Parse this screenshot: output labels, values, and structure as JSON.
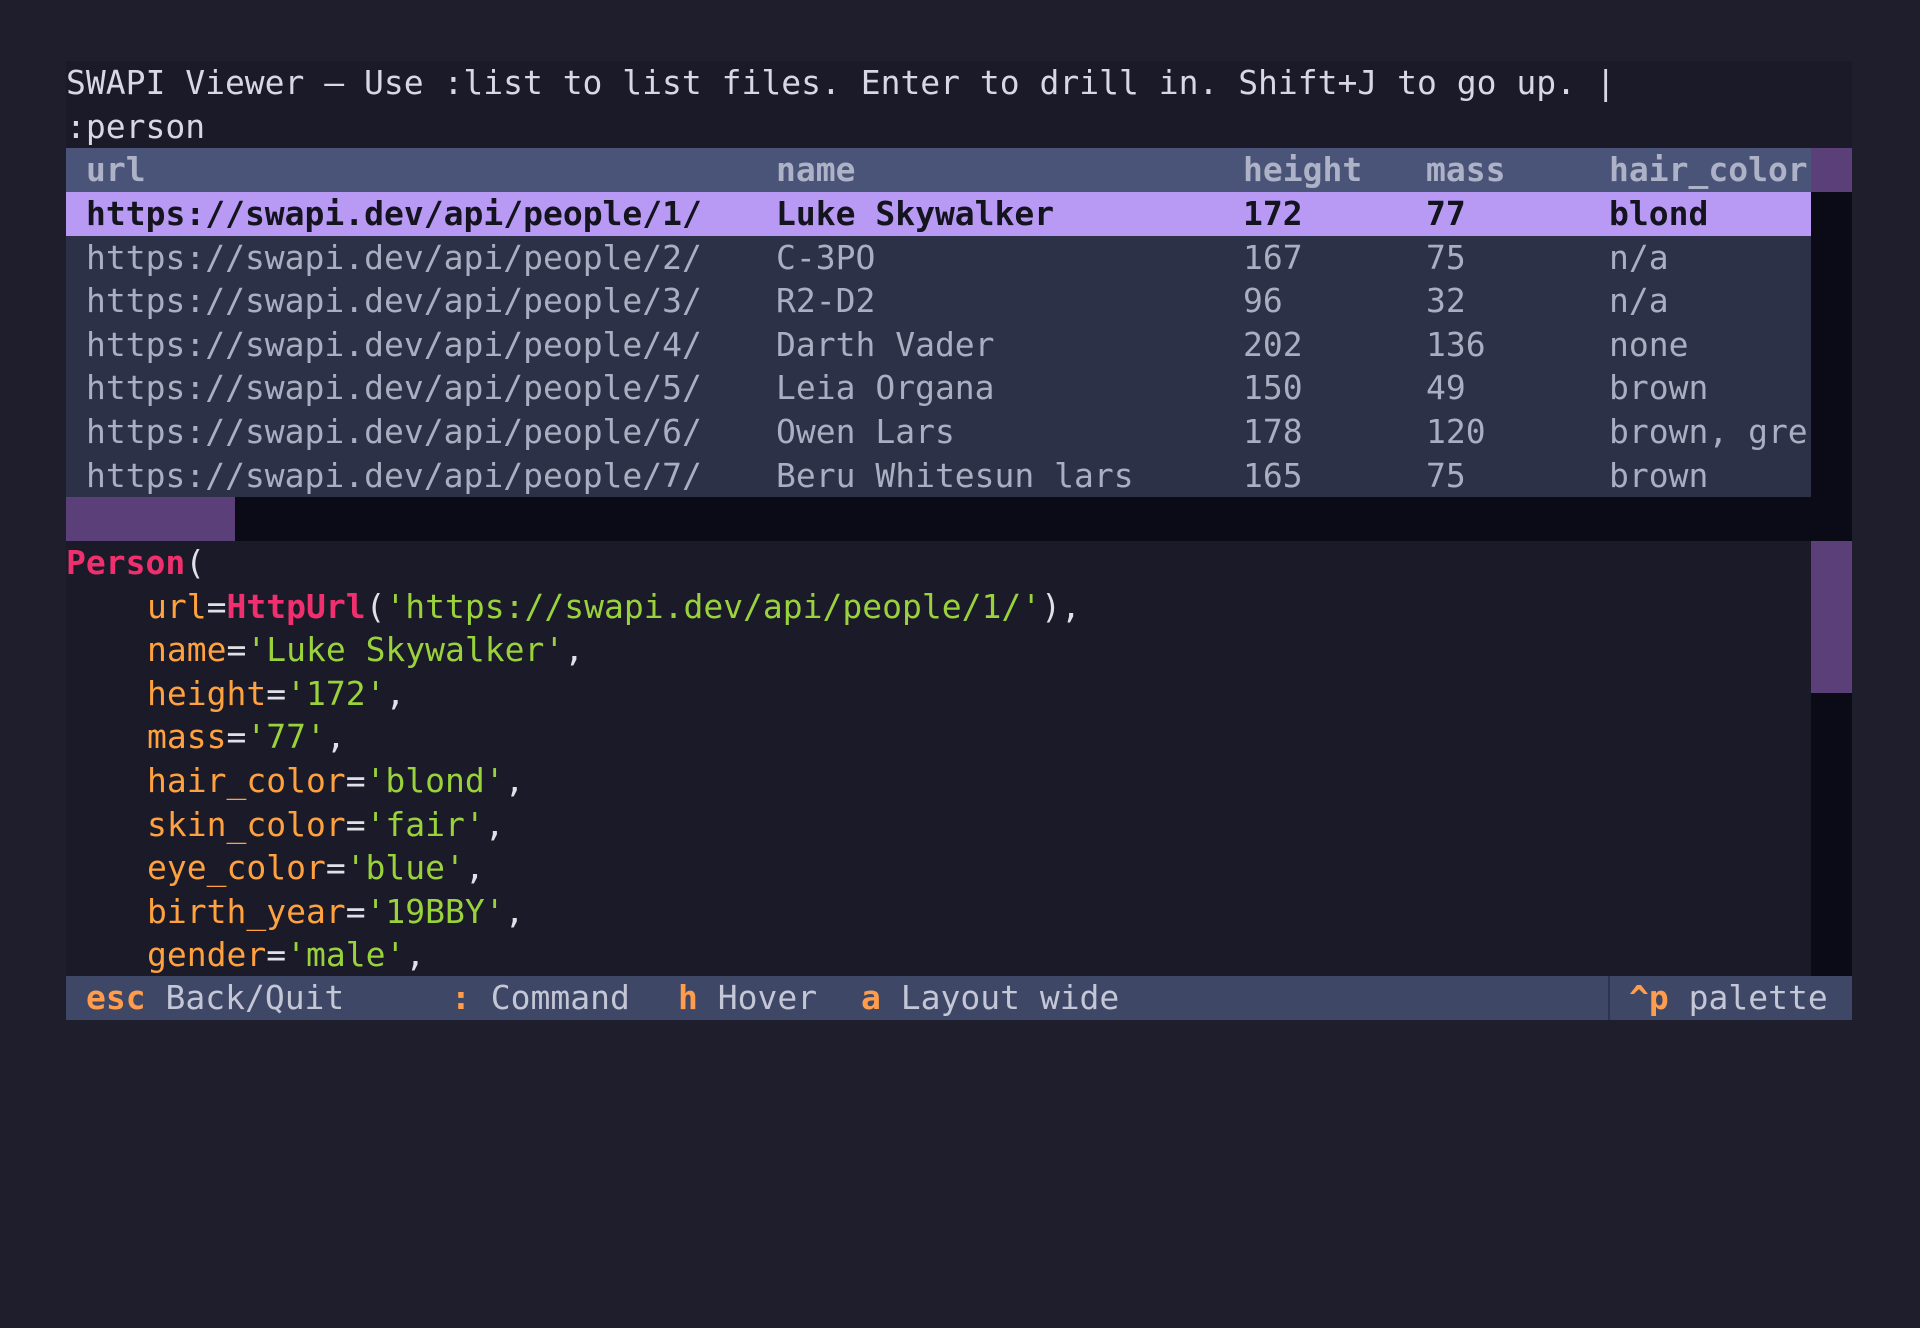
{
  "header": {
    "line1": "SWAPI Viewer — Use :list to list files. Enter to drill in. Shift+J to go up. |",
    "line2": ":person"
  },
  "table": {
    "columns": [
      "url",
      "name",
      "height",
      "mass",
      "hair_color"
    ],
    "rows": [
      {
        "url": "https://swapi.dev/api/people/1/",
        "name": "Luke Skywalker",
        "height": "172",
        "mass": "77",
        "hair_color": "blond",
        "selected": true
      },
      {
        "url": "https://swapi.dev/api/people/2/",
        "name": "C-3PO",
        "height": "167",
        "mass": "75",
        "hair_color": "n/a"
      },
      {
        "url": "https://swapi.dev/api/people/3/",
        "name": "R2-D2",
        "height": "96",
        "mass": "32",
        "hair_color": "n/a"
      },
      {
        "url": "https://swapi.dev/api/people/4/",
        "name": "Darth Vader",
        "height": "202",
        "mass": "136",
        "hair_color": "none"
      },
      {
        "url": "https://swapi.dev/api/people/5/",
        "name": "Leia Organa",
        "height": "150",
        "mass": "49",
        "hair_color": "brown"
      },
      {
        "url": "https://swapi.dev/api/people/6/",
        "name": "Owen Lars",
        "height": "178",
        "mass": "120",
        "hair_color": "brown, gre"
      },
      {
        "url": "https://swapi.dev/api/people/7/",
        "name": "Beru Whitesun lars",
        "height": "165",
        "mass": "75",
        "hair_color": "brown"
      }
    ]
  },
  "detail": {
    "class_name": "Person",
    "open_paren": "(",
    "fields": [
      {
        "key": "url",
        "eq": "=",
        "ctor": "HttpUrl",
        "value": "'https://swapi.dev/api/people/1/'",
        "tail": "),"
      },
      {
        "key": "name",
        "eq": "=",
        "value": "'Luke Skywalker'",
        "tail": ","
      },
      {
        "key": "height",
        "eq": "=",
        "value": "'172'",
        "tail": ","
      },
      {
        "key": "mass",
        "eq": "=",
        "value": "'77'",
        "tail": ","
      },
      {
        "key": "hair_color",
        "eq": "=",
        "value": "'blond'",
        "tail": ","
      },
      {
        "key": "skin_color",
        "eq": "=",
        "value": "'fair'",
        "tail": ","
      },
      {
        "key": "eye_color",
        "eq": "=",
        "value": "'blue'",
        "tail": ","
      },
      {
        "key": "birth_year",
        "eq": "=",
        "value": "'19BBY'",
        "tail": ","
      },
      {
        "key": "gender",
        "eq": "=",
        "value": "'male'",
        "tail": ","
      }
    ]
  },
  "footer": {
    "bindings": [
      {
        "key": "esc",
        "label": "Back/Quit"
      },
      {
        "key": ":",
        "label": "Command"
      },
      {
        "key": "h",
        "label": "Hover"
      },
      {
        "key": "a",
        "label": "Layout wide"
      }
    ],
    "palette": {
      "key": "^p",
      "label": "palette"
    }
  },
  "colors": {
    "background": "#1e1e2c",
    "header_row": "#4a5478",
    "selected_row": "#b89af5",
    "scrollbar": "#5a3f78",
    "keyword": "#f0306e",
    "field_key": "#ffa13e",
    "string": "#9ad23c",
    "footer_key": "#ff9d4d",
    "footer_bg": "#3f4766"
  }
}
